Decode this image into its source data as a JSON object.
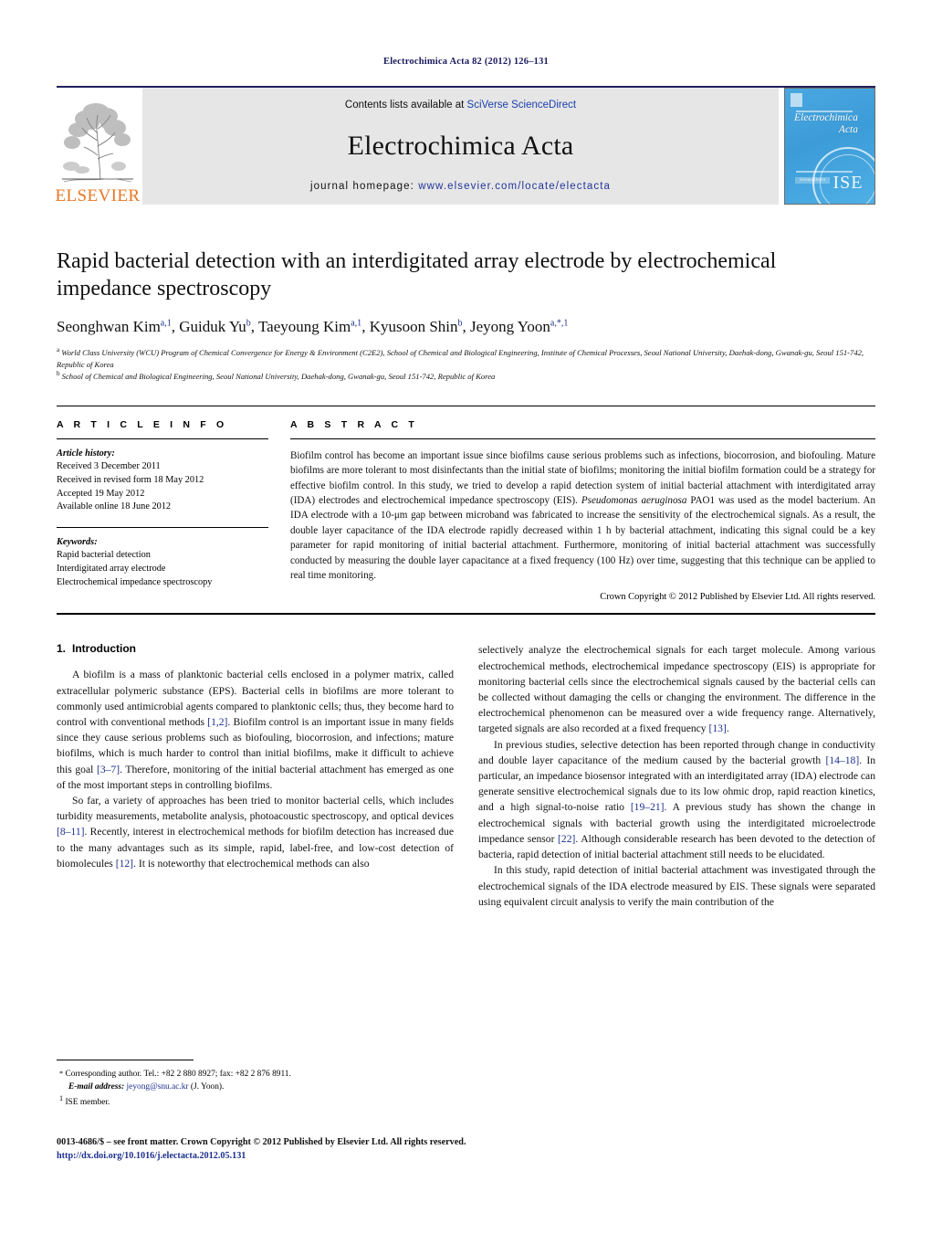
{
  "running_head": "Electrochimica Acta 82 (2012) 126–131",
  "masthead": {
    "contents_prefix": "Contents lists available at ",
    "contents_sci": "SciVerse",
    "contents_direct": " ScienceDirect",
    "journal_title": "Electrochimica Acta",
    "homepage_label": "journal homepage:",
    "homepage_url": " www.elsevier.com/locate/electacta",
    "publisher_wordmark": "ELSEVIER",
    "cover_title_line1": "Electrochimica",
    "cover_title_line2": "Acta",
    "cover_badge": "ScienceDirect",
    "cover_seal": "ISE"
  },
  "article": {
    "title": "Rapid bacterial detection with an interdigitated array electrode by electrochemical impedance spectroscopy",
    "authors_html": "Seonghwan Kim<sup>a,1</sup>, Guiduk Yu<sup>b</sup>, Taeyoung Kim<sup>a,1</sup>, Kyusoon Shin<sup>b</sup>, Jeyong Yoon<sup>a,*,1</sup>",
    "affiliation_a": "World Class University (WCU) Program of Chemical Convergence for Energy & Environment (C2E2), School of Chemical and Biological Engineering, Institute of Chemical Processes, Seoul National University, Daehak-dong, Gwanak-gu, Seoul 151-742, Republic of Korea",
    "affiliation_b": "School of Chemical and Biological Engineering, Seoul National University, Daehak-dong, Gwanak-gu, Seoul 151-742, Republic of Korea"
  },
  "article_info": {
    "heading": "A R T I C L E    I N F O",
    "history_label": "Article history:",
    "history": [
      "Received 3 December 2011",
      "Received in revised form 18 May 2012",
      "Accepted 19 May 2012",
      "Available online 18 June 2012"
    ],
    "keywords_label": "Keywords:",
    "keywords": [
      "Rapid bacterial detection",
      "Interdigitated array electrode",
      "Electrochemical impedance spectroscopy"
    ]
  },
  "abstract": {
    "heading": "A B S T R A C T",
    "part1": "Biofilm control has become an important issue since biofilms cause serious problems such as infections, biocorrosion, and biofouling. Mature biofilms are more tolerant to most disinfectants than the initial state of biofilms; monitoring the initial biofilm formation could be a strategy for effective biofilm control. In this study, we tried to develop a rapid detection system of initial bacterial attachment with interdigitated array (IDA) electrodes and electrochemical impedance spectroscopy (EIS). ",
    "species": "Pseudomonas aeruginosa",
    "part2": " PAO1 was used as the model bacterium. An IDA electrode with a 10-μm gap between microband was fabricated to increase the sensitivity of the electrochemical signals. As a result, the double layer capacitance of the IDA electrode rapidly decreased within 1 h by bacterial attachment, indicating this signal could be a key parameter for rapid monitoring of initial bacterial attachment. Furthermore, monitoring of initial bacterial attachment was successfully conducted by measuring the double layer capacitance at a fixed frequency (100 Hz) over time, suggesting that this technique can be applied to real time monitoring.",
    "copyright": "Crown Copyright © 2012 Published by Elsevier Ltd. All rights reserved."
  },
  "introduction": {
    "number": "1.",
    "heading": "Introduction",
    "left_p1_a": "A biofilm is a mass of planktonic bacterial cells enclosed in a polymer matrix, called extracellular polymeric substance (EPS). Bacterial cells in biofilms are more tolerant to commonly used antimicrobial agents compared to planktonic cells; thus, they become hard to control with conventional methods ",
    "left_p1_c1": "[1,2]",
    "left_p1_b": ". Biofilm control is an important issue in many fields since they cause serious problems such as biofouling, biocorrosion, and infections; mature biofilms, which is much harder to control than initial biofilms, make it difficult to achieve this goal ",
    "left_p1_c2": "[3–7]",
    "left_p1_d": ". Therefore, monitoring of the initial bacterial attachment has emerged as one of the most important steps in controlling biofilms.",
    "left_p2_a": "So far, a variety of approaches has been tried to monitor bacterial cells, which includes turbidity measurements, metabolite analysis, photoacoustic spectroscopy, and optical devices ",
    "left_p2_c1": "[8–11]",
    "left_p2_b": ". Recently, interest in electrochemical methods for biofilm detection has increased due to the many advantages such as its simple, rapid, label-free, and low-cost detection of biomolecules ",
    "left_p2_c2": "[12]",
    "left_p2_d": ". It is noteworthy that electrochemical methods can also",
    "right_p1_a": "selectively analyze the electrochemical signals for each target molecule. Among various electrochemical methods, electrochemical impedance spectroscopy (EIS) is appropriate for monitoring bacterial cells since the electrochemical signals caused by the bacterial cells can be collected without damaging the cells or changing the environment. The difference in the electrochemical phenomenon can be measured over a wide frequency range. Alternatively, targeted signals are also recorded at a fixed frequency ",
    "right_p1_c1": "[13]",
    "right_p1_b": ".",
    "right_p2_a": "In previous studies, selective detection has been reported through change in conductivity and double layer capacitance of the medium caused by the bacterial growth ",
    "right_p2_c1": "[14–18]",
    "right_p2_b": ". In particular, an impedance biosensor integrated with an interdigitated array (IDA) electrode can generate sensitive electrochemical signals due to its low ohmic drop, rapid reaction kinetics, and a high signal-to-noise ratio ",
    "right_p2_c2": "[19–21]",
    "right_p2_c": ". A previous study has shown the change in electrochemical signals with bacterial growth using the interdigitated microelectrode impedance sensor ",
    "right_p2_c3": "[22]",
    "right_p2_d": ". Although considerable research has been devoted to the detection of bacteria, rapid detection of initial bacterial attachment still needs to be elucidated.",
    "right_p3": "In this study, rapid detection of initial bacterial attachment was investigated through the electrochemical signals of the IDA electrode measured by EIS. These signals were separated using equivalent circuit analysis to verify the main contribution of the"
  },
  "footnotes": {
    "corresponding_mark": "*",
    "corresponding_text": "Corresponding author. Tel.: +82 2 880 8927; fax: +82 2 876 8911.",
    "email_label": "E-mail address:",
    "email": "jeyong@snu.ac.kr",
    "email_suffix": " (J. Yoon).",
    "ise_mark": "1",
    "ise_text": "ISE member."
  },
  "footer": {
    "issn_line": "0013-4686/$ – see front matter. Crown Copyright © 2012 Published by Elsevier Ltd. All rights reserved.",
    "doi": "http://dx.doi.org/10.1016/j.electacta.2012.05.131"
  }
}
